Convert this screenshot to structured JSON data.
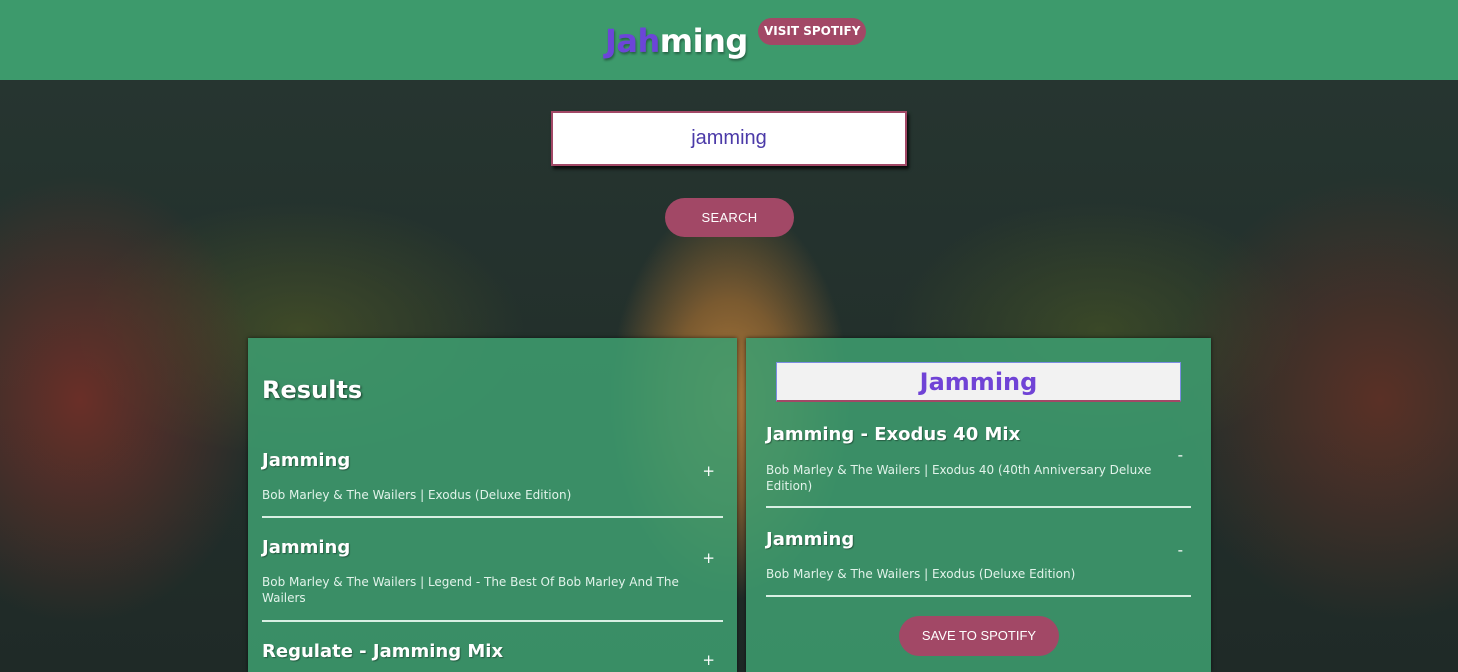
{
  "header": {
    "logo_part1": "Jah",
    "logo_part2": "ming",
    "visit_label": "VISIT SPOTIFY"
  },
  "search": {
    "value": "jamming",
    "button_label": "SEARCH"
  },
  "results": {
    "title": "Results",
    "tracks": [
      {
        "name": "Jamming",
        "info": "Bob Marley & The Wailers | Exodus (Deluxe Edition)",
        "action": "+"
      },
      {
        "name": "Jamming",
        "info": "Bob Marley & The Wailers | Legend - The Best Of Bob Marley And The Wailers",
        "action": "+"
      },
      {
        "name": "Regulate - Jamming Mix",
        "info": "",
        "action": "+"
      }
    ]
  },
  "playlist": {
    "name": "Jamming",
    "tracks": [
      {
        "name": "Jamming - Exodus 40 Mix",
        "info": "Bob Marley & The Wailers | Exodus 40 (40th Anniversary Deluxe Edition)",
        "action": "-"
      },
      {
        "name": "Jamming",
        "info": "Bob Marley & The Wailers | Exodus (Deluxe Edition)",
        "action": "-"
      }
    ],
    "save_label": "SAVE TO SPOTIFY"
  },
  "colors": {
    "header_bg": "#3d9a6c",
    "accent": "#a24866",
    "logo_purple": "#6c45d8"
  }
}
